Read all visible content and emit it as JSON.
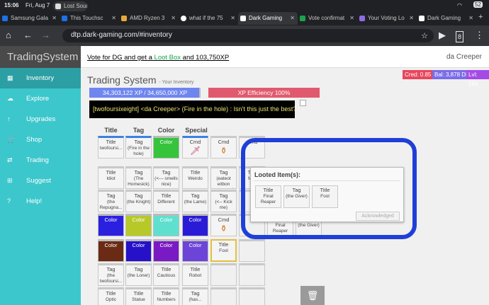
{
  "status": {
    "time": "15:06",
    "date": "Fri, Aug 7",
    "battery": "52"
  },
  "tabs": [
    {
      "label": "Lost Soul",
      "color": "#dddddd"
    },
    {
      "label": "Samsung Gala",
      "color": "#1a73e8"
    },
    {
      "label": "This Touchsc",
      "color": "#1a73e8"
    },
    {
      "label": "AMD Ryzen 3",
      "color": "#e8a93a"
    },
    {
      "label": "what if the 75",
      "color": "#ffffff"
    },
    {
      "label": "Dark Gaming",
      "color": "#ffffff"
    },
    {
      "label": "Vote confirmat",
      "color": "#1aa54a"
    },
    {
      "label": "Your Voting Lo",
      "color": "#8e6be8"
    },
    {
      "label": "Dark Gaming",
      "color": "#ffffff"
    }
  ],
  "url": "dtp.dark-gaming.com/#inventory",
  "brand": "TradingSystem",
  "promo": {
    "a": "Vote for DG and get a ",
    "b": "Loot Box",
    "c": " and 103,750XP"
  },
  "user": "da Creeper",
  "badges": {
    "cred": "Cred: 0.85",
    "bal": "Bal: 3,878 DP",
    "lvl": "Lvl: 164"
  },
  "sidebar": [
    {
      "label": "Inventory",
      "icon": "grid-icon"
    },
    {
      "label": "Explore",
      "icon": "cloud-icon"
    },
    {
      "label": "Upgrades",
      "icon": "arrow-up-icon"
    },
    {
      "label": "Shop",
      "icon": "cart-icon"
    },
    {
      "label": "Trading",
      "icon": "trade-icon"
    },
    {
      "label": "Suggest",
      "icon": "plus-icon"
    },
    {
      "label": "Help!",
      "icon": "question-icon"
    }
  ],
  "page": {
    "title": "Trading System",
    "subtitle": "- Your Inventory"
  },
  "xp": {
    "text": "34,303,122 XP / 34,650,000 XP",
    "fraction": 0.99
  },
  "efficiency": "XP Efficiency 100%",
  "chat": "[twofoursixeight] <da Creeper> (Fire in the hole) : Isn't this just the best?",
  "columns": [
    "Title",
    "Tag",
    "Color",
    "Special"
  ],
  "inventory": [
    [
      {
        "k": "Title",
        "s": "twofoursi..."
      },
      {
        "k": "Tag",
        "s": "(Fire in the hole)"
      },
      {
        "k": "Color",
        "c": "#35c43c"
      },
      {
        "k": "Cmd",
        "i": "sword"
      },
      {
        "k": "Cmd",
        "i": "potion"
      },
      {
        "k": "Cmd",
        "s": ""
      }
    ],
    [
      {
        "k": "Title",
        "s": "Idiot"
      },
      {
        "k": "Tag",
        "s": "(The Homesick)"
      },
      {
        "k": "Tag",
        "s": "(<--- smells nice)"
      },
      {
        "k": "Title",
        "s": "Weirdo"
      },
      {
        "k": "Tag",
        "s": "(eateot eitbon natmos...)"
      },
      {
        "k": "Tag",
        "s": "M..."
      }
    ],
    [
      {
        "k": "Tag",
        "s": "(the Repugna..."
      },
      {
        "k": "Tag",
        "s": "(the Knight)"
      },
      {
        "k": "Title",
        "s": "Different"
      },
      {
        "k": "Tag",
        "s": "(the Lame)"
      },
      {
        "k": "Tag",
        "s": "(<-- Kick me)"
      },
      {
        "k": "",
        "s": ""
      }
    ],
    [
      {
        "k": "Color",
        "c": "#2b20e0"
      },
      {
        "k": "Color",
        "c": "#b7c928"
      },
      {
        "k": "Color",
        "c": "#5fe0cf"
      },
      {
        "k": "Color",
        "c": "#2a1cd6"
      },
      {
        "k": "Cmd",
        "i": "potion"
      },
      {
        "k": "",
        "s": ""
      }
    ],
    [
      {
        "k": "Color",
        "c": "#6b2a14"
      },
      {
        "k": "Color",
        "c": "#2711c8"
      },
      {
        "k": "Color",
        "c": "#7a1ac4"
      },
      {
        "k": "Color",
        "c": "#6c45d8"
      },
      {
        "k": "Title",
        "s": "Fool",
        "sel": true
      },
      {
        "k": "",
        "s": ""
      }
    ],
    [
      {
        "k": "Tag",
        "s": "(the twofoursi..."
      },
      {
        "k": "Tag",
        "s": "(the Loner)"
      },
      {
        "k": "Title",
        "s": "Cautious"
      },
      {
        "k": "Title",
        "s": "Robot"
      },
      {
        "k": "",
        "s": ""
      },
      {
        "k": "",
        "s": ""
      }
    ],
    [
      {
        "k": "Title",
        "s": "Optic"
      },
      {
        "k": "Title",
        "s": "Statue"
      },
      {
        "k": "Title",
        "s": "Numbers"
      },
      {
        "k": "Tag",
        "s": "(has..."
      },
      {
        "k": "",
        "s": ""
      },
      {
        "k": "",
        "s": ""
      }
    ]
  ],
  "behind": [
    {
      "k": "",
      "s": "Final Reaper"
    },
    {
      "k": "",
      "s": "(the Giver)"
    }
  ],
  "modal": {
    "title": "Looted Item(s):",
    "items": [
      {
        "k": "Title",
        "s": "Final Reaper"
      },
      {
        "k": "Tag",
        "s": "(the Giver)"
      },
      {
        "k": "Title",
        "s": "Fool"
      }
    ],
    "button": "Acknowledged"
  }
}
